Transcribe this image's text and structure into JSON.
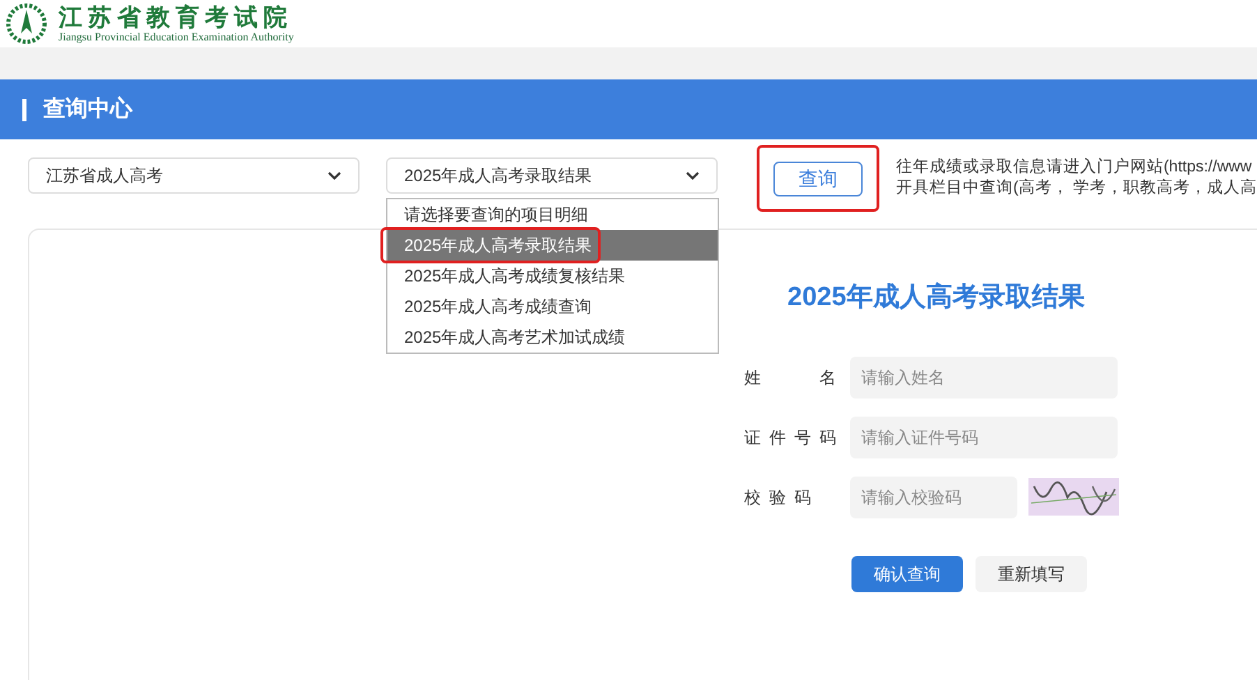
{
  "header": {
    "title": "江苏省教育考试院",
    "subtitle": "Jiangsu Provincial Education Examination Authority"
  },
  "section_title": "查询中心",
  "filters": {
    "category_select": {
      "value": "江苏省成人高考"
    },
    "item_select": {
      "value": "2025年成人高考录取结果",
      "expanded": true,
      "options": [
        {
          "label": "请选择要查询的项目明细",
          "selected": false
        },
        {
          "label": "2025年成人高考录取结果",
          "selected": true
        },
        {
          "label": "2025年成人高考成绩复核结果",
          "selected": false
        },
        {
          "label": "2025年成人高考成绩查询",
          "selected": false
        },
        {
          "label": "2025年成人高考艺术加试成绩",
          "selected": false
        }
      ]
    },
    "query_button": "查询",
    "notice_lines": [
      "往年成绩或录取信息请进入门户网站(https://www",
      "开具栏目中查询(高考， 学考，职教高考，成人高"
    ]
  },
  "form": {
    "title": "2025年成人高考录取结果",
    "fields": [
      {
        "label": "姓　　名",
        "placeholder": "请输入姓名",
        "kind": "text"
      },
      {
        "label": "证件号码",
        "placeholder": "请输入证件号码",
        "kind": "text"
      },
      {
        "label": "校验码",
        "placeholder": "请输入校验码",
        "kind": "captcha"
      }
    ],
    "buttons": [
      {
        "label": "确认查询",
        "kind": "primary"
      },
      {
        "label": "重新填写",
        "kind": "secondary"
      }
    ]
  }
}
